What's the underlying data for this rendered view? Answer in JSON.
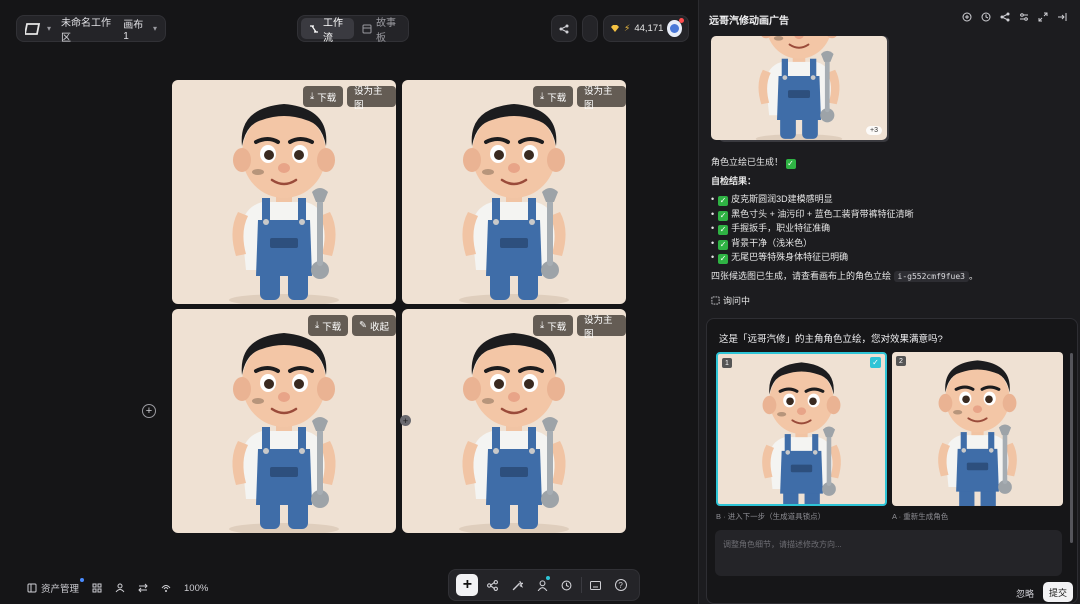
{
  "topbar": {
    "workspace": "未命名工作区",
    "canvas": "画布 1",
    "tab_workflow": "工作流",
    "tab_storyboard": "故事板",
    "credits": "44,171"
  },
  "tiles": [
    {
      "btn1": "下载",
      "btn2": "设为主图"
    },
    {
      "btn1": "下载",
      "btn2": "设为主图"
    },
    {
      "btn1": "下载",
      "btn2": "收起"
    },
    {
      "btn1": "下载",
      "btn2": "设为主图"
    }
  ],
  "badge_text": "远哥汽修",
  "bottom": {
    "assets": "资产管理",
    "zoom": "100%"
  },
  "panel": {
    "title": "远哥汽修动画广告",
    "more_count": "+3",
    "generated": "角色立绘已生成！",
    "self_check": "自检结果：",
    "checks": [
      "皮克斯圆润3D建模感明显",
      "黑色寸头 + 油污印 + 蓝色工装背带裤特征清晰",
      "手握扳手，职业特征准确",
      "背景干净（浅米色）",
      "无尾巴等特殊身体特征已明确"
    ],
    "summary_pre": "四张候选图已生成，请查看画布上的角色立绘",
    "summary_code": "i-g552cmf9fue3",
    "summary_post": "。",
    "asking": "询问中",
    "question": "这是「远哥汽修」的主角角色立绘，您对效果满意吗?",
    "opt1_num": "1",
    "opt2_num": "2",
    "opt1_label": "B · 进入下一步（生成道具锁点）",
    "opt2_label": "A · 重新生成角色",
    "input_placeholder": "调整角色细节，请描述修改方向...",
    "ignore": "忽略",
    "submit": "提交"
  },
  "colors": {
    "accent": "#2ec4d6",
    "check": "#2fb344",
    "tile_bg": "#efe1d3",
    "overalls": "#3f6da8"
  }
}
